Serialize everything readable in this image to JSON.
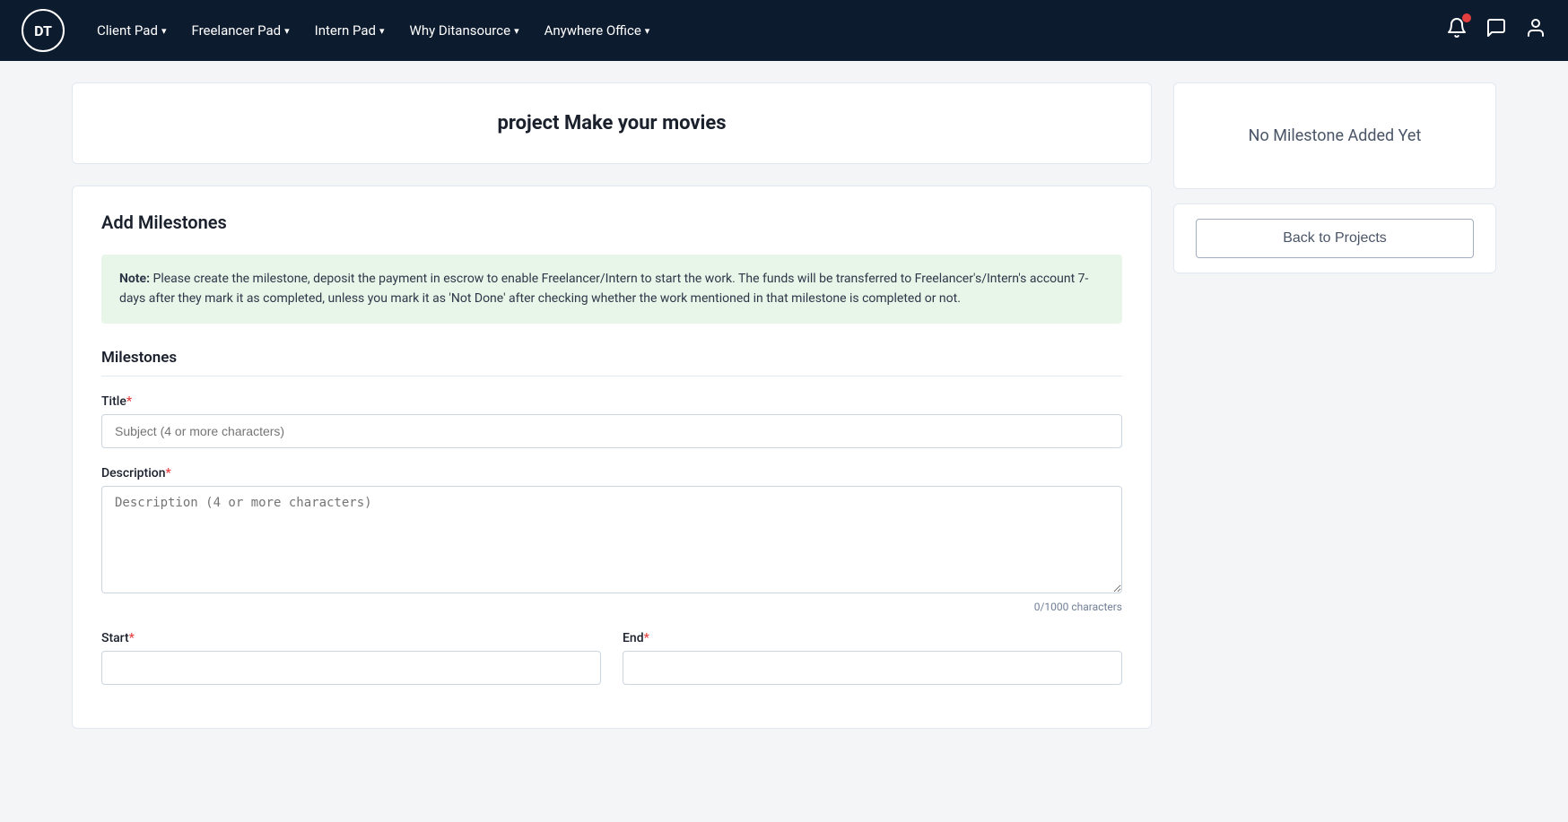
{
  "navbar": {
    "logo_text": "DT",
    "nav_items": [
      {
        "label": "Client Pad",
        "id": "client-pad"
      },
      {
        "label": "Freelancer Pad",
        "id": "freelancer-pad"
      },
      {
        "label": "Intern Pad",
        "id": "intern-pad"
      },
      {
        "label": "Why Ditansource",
        "id": "why-ditansource"
      },
      {
        "label": "Anywhere Office",
        "id": "anywhere-office"
      }
    ]
  },
  "project_header": {
    "title": "project Make your movies"
  },
  "add_milestones": {
    "section_title": "Add Milestones",
    "note_label": "Note:",
    "note_text": "  Please create the milestone, deposit the payment in escrow to enable Freelancer/Intern to start the work. The funds will be transferred to Freelancer's/Intern's account 7-days after they mark it as completed, unless you mark it as 'Not Done' after checking whether the work mentioned in that milestone is completed or not.",
    "subsection_title": "Milestones",
    "title_label": "Title",
    "title_placeholder": "Subject (4 or more characters)",
    "description_label": "Description",
    "description_placeholder": "Description (4 or more characters)",
    "char_count": "0/1000 characters",
    "start_label": "Start",
    "end_label": "End"
  },
  "sidebar": {
    "empty_milestone_text": "No Milestone Added Yet",
    "back_button_label": "Back to Projects"
  }
}
